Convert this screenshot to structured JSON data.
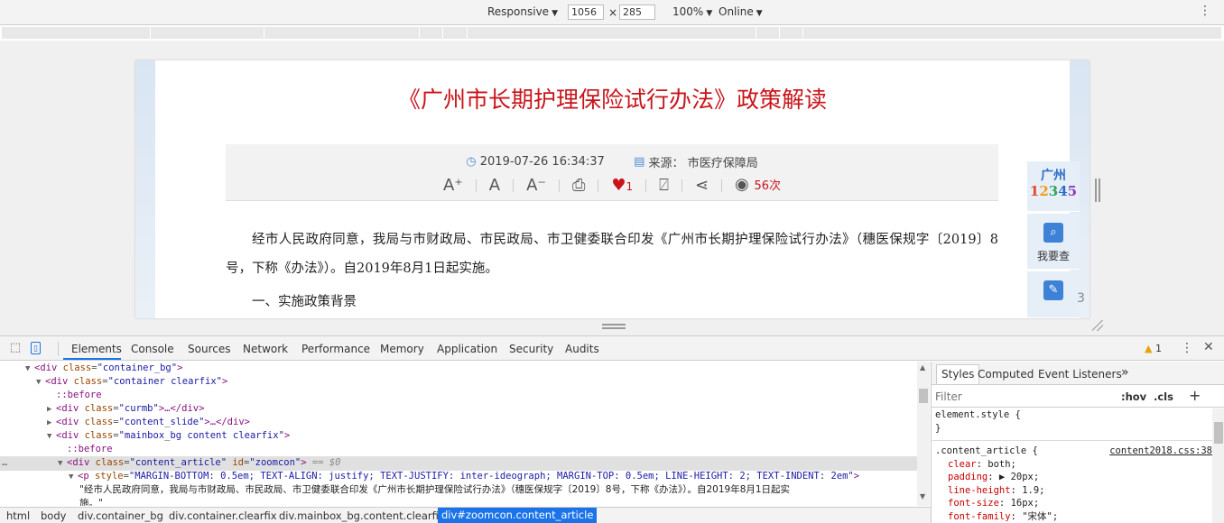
{
  "device_toolbar": {
    "device": "Responsive",
    "width": "1056",
    "times": "×",
    "height": "285",
    "zoom": "100%",
    "network": "Online",
    "caret": "▼",
    "more_icon": "⋮"
  },
  "article": {
    "title": "《广州市长期护理保险试行办法》政策解读",
    "date": "2019-07-26 16:34:37",
    "source_label": "来源：",
    "source": "市医疗保障局",
    "tools": {
      "font_increase": "A⁺",
      "font_normal": "A",
      "font_decrease": "A⁻",
      "likes": "1",
      "views": "56次"
    },
    "paragraphs": [
      "经市人民政府同意，我局与市财政局、市民政局、市卫健委联合印发《广州市长期护理保险试行办法》（穗医保规字〔2019〕8号，下称《办法》）。自2019年8月1日起实施。",
      "一、实施政策背景"
    ]
  },
  "side_widget": {
    "hotline_city": "广州",
    "hotline_number": "12345",
    "check_label": "我要查",
    "write_label": "我要写",
    "page_number": "3"
  },
  "devtools": {
    "tabs": [
      "Elements",
      "Console",
      "Sources",
      "Network",
      "Performance",
      "Memory",
      "Application",
      "Security",
      "Audits"
    ],
    "warning_count": "1",
    "tree": [
      {
        "indent": 0,
        "tri": "▼",
        "html": "div",
        "cls": "container_bg"
      },
      {
        "indent": 1,
        "tri": "▼",
        "html": "div",
        "cls": "container clearfix"
      },
      {
        "indent": 2,
        "pseudo": "::before"
      },
      {
        "indent": 2,
        "tri": "▶",
        "html": "div",
        "cls": "curmb",
        "collapsed": "…</div>"
      },
      {
        "indent": 2,
        "tri": "▶",
        "html": "div",
        "cls": "content_slide",
        "collapsed": "…</div>"
      },
      {
        "indent": 2,
        "tri": "▼",
        "html": "div",
        "cls": "mainbox_bg content clearfix"
      },
      {
        "indent": 3,
        "pseudo": "::before"
      },
      {
        "indent": 3,
        "tri": "▼",
        "html": "div",
        "cls": "content_article",
        "id": "zoomcon",
        "selected_marker": "== $0"
      },
      {
        "indent": 4,
        "tri": "▼",
        "html": "p",
        "style": "MARGIN-BOTTOM: 0.5em; TEXT-ALIGN: justify; TEXT-JUSTIFY: inter-ideograph; MARGIN-TOP: 0.5em; LINE-HEIGHT: 2; TEXT-INDENT: 2em"
      },
      {
        "indent": 5,
        "text": "\"经市人民政府同意，我局与市财政局、市民政局、市卫健委联合印发《广州市长期护理保险试行办法》（穗医保规字〔2019〕8号，下称《办法》）。自2019年8月1日起实"
      },
      {
        "indent": 5,
        "text": "施。\""
      }
    ],
    "breadcrumb": [
      "html",
      "body",
      "div.container_bg",
      "div.container.clearfix",
      "div.mainbox_bg.content.clearfix",
      "div#zoomcon.content_article"
    ],
    "styles": {
      "tabs": [
        "Styles",
        "Computed",
        "Event Listeners",
        "»"
      ],
      "filter_placeholder": "Filter",
      "hov": ":hov",
      "cls": ".cls",
      "plus": "+",
      "element_style": "element.style {",
      "close_brace": "}",
      "rule_selector": ".content_article {",
      "rule_source": "content2018.css:38",
      "declarations": [
        {
          "prop": "clear",
          "val": "both;"
        },
        {
          "prop": "padding",
          "val": "▶ 20px;"
        },
        {
          "prop": "line-height",
          "val": "1.9;"
        },
        {
          "prop": "font-size",
          "val": "16px;"
        },
        {
          "prop": "font-family",
          "val": "\"宋体\";"
        }
      ]
    }
  }
}
